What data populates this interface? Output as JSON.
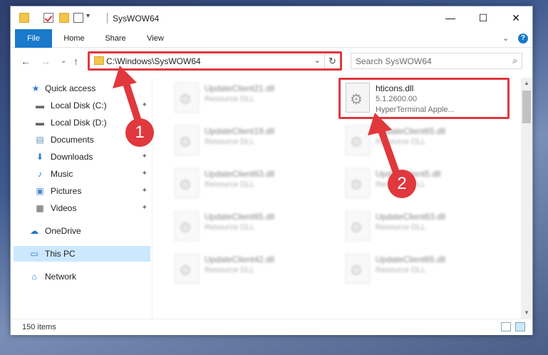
{
  "window": {
    "title": "SysWOW64",
    "minimize_glyph": "—",
    "maximize_glyph": "☐",
    "close_glyph": "✕"
  },
  "ribbon": {
    "tabs": [
      "File",
      "Home",
      "Share",
      "View"
    ],
    "expand_glyph": "⌄",
    "help_glyph": "?"
  },
  "nav": {
    "back_glyph": "←",
    "forward_glyph": "→",
    "recent_glyph": "⌄",
    "up_glyph": "↑",
    "address": "C:\\Windows\\SysWOW64",
    "address_drop_glyph": "⌄",
    "refresh_glyph": "↻",
    "search_placeholder": "Search SysWOW64",
    "search_glyph": "⌕"
  },
  "sidebar": {
    "items": [
      {
        "label": "Quick access",
        "icon": "star-icon"
      },
      {
        "label": "Local Disk (C:)",
        "icon": "drive-icon",
        "pinned": true
      },
      {
        "label": "Local Disk (D:)",
        "icon": "drive-icon",
        "pinned": true
      },
      {
        "label": "Documents",
        "icon": "documents-icon",
        "pinned": true
      },
      {
        "label": "Downloads",
        "icon": "downloads-icon",
        "pinned": true
      },
      {
        "label": "Music",
        "icon": "music-icon",
        "pinned": true
      },
      {
        "label": "Pictures",
        "icon": "pictures-icon",
        "pinned": true
      },
      {
        "label": "Videos",
        "icon": "videos-icon",
        "pinned": true
      },
      {
        "label": "OneDrive",
        "icon": "cloud-icon"
      },
      {
        "label": "This PC",
        "icon": "pc-icon",
        "selected": true
      },
      {
        "label": "Network",
        "icon": "network-icon"
      }
    ],
    "pin_glyph": "📌"
  },
  "files": {
    "left": [
      {
        "name": "UpdateClient21.dll",
        "type": "Resource DLL"
      },
      {
        "name": "UpdateClient19.dll",
        "type": "Resource DLL"
      },
      {
        "name": "UpdateClient63.dll",
        "type": "Resource DLL"
      },
      {
        "name": "UpdateClient65.dll",
        "type": "Resource DLL"
      },
      {
        "name": "UpdateClient42.dll",
        "type": "Resource DLL"
      }
    ],
    "right": [
      {
        "name": "UpdateClient65.dll",
        "type": "Resource DLL"
      },
      {
        "name": "UpdateClient5.dll",
        "type": "Resource DLL"
      },
      {
        "name": "UpdateClient63.dll",
        "type": "Resource DLL"
      },
      {
        "name": "UpdateClient65.dll",
        "type": "Resource DLL"
      }
    ],
    "highlighted": {
      "name": "hticons.dll",
      "version": "5.1.2600.00",
      "description": "HyperTerminal Apple..."
    }
  },
  "status": {
    "item_count": "150 items"
  },
  "annotations": {
    "badge1": "1",
    "badge2": "2",
    "color": "#e0383d"
  }
}
